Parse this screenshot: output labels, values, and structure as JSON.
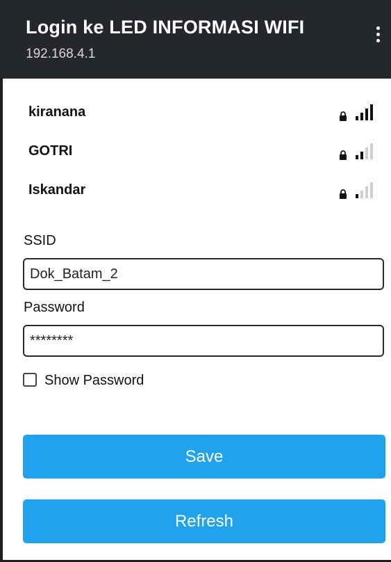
{
  "header": {
    "title": "Login ke LED INFORMASI WIFI",
    "subtitle": "192.168.4.1"
  },
  "networks": [
    {
      "name": "kiranana",
      "secured": true,
      "signal_bars": 4
    },
    {
      "name": "GOTRI",
      "secured": true,
      "signal_bars": 2
    },
    {
      "name": "Iskandar",
      "secured": true,
      "signal_bars": 1
    }
  ],
  "form": {
    "ssid_label": "SSID",
    "ssid_value": "Dok_Batam_2",
    "password_label": "Password",
    "password_value": "********",
    "show_password_label": "Show Password",
    "show_password_checked": false
  },
  "buttons": {
    "save_label": "Save",
    "refresh_label": "Refresh"
  },
  "colors": {
    "header_bg": "#24282c",
    "button_bg": "#1fa3ec",
    "signal_active": "#111111",
    "signal_inactive": "#cfcfcf"
  }
}
